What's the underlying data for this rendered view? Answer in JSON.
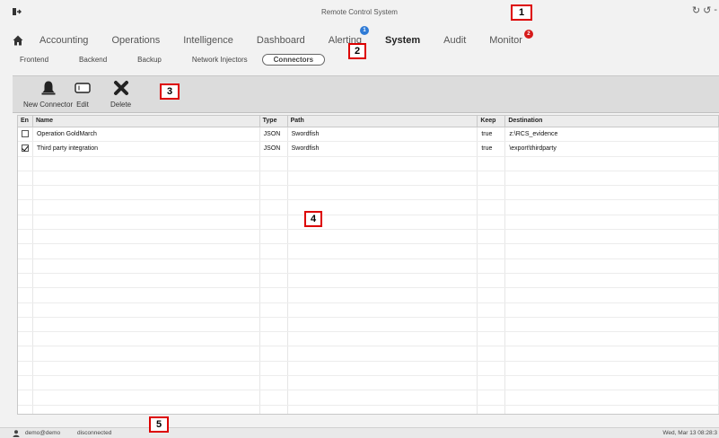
{
  "window": {
    "title": "Remote Control System"
  },
  "main_nav": {
    "items": [
      {
        "label": "Accounting",
        "active": false
      },
      {
        "label": "Operations",
        "active": false
      },
      {
        "label": "Intelligence",
        "active": false
      },
      {
        "label": "Dashboard",
        "active": false
      },
      {
        "label": "Alerting",
        "active": false,
        "badge": "1",
        "badge_color": "#2f7bd6"
      },
      {
        "label": "System",
        "active": true
      },
      {
        "label": "Audit",
        "active": false
      },
      {
        "label": "Monitor",
        "active": false,
        "badge": "2",
        "badge_color": "#d61a1a"
      }
    ]
  },
  "sub_nav": {
    "items": [
      {
        "label": "Frontend",
        "active": false
      },
      {
        "label": "Backend",
        "active": false
      },
      {
        "label": "Backup",
        "active": false
      },
      {
        "label": "Network Injectors",
        "active": false
      },
      {
        "label": "Connectors",
        "active": true
      }
    ]
  },
  "toolbar": {
    "new_connector": "New Connector",
    "edit": "Edit",
    "delete": "Delete"
  },
  "table": {
    "columns": [
      "En",
      "Name",
      "Type",
      "Path",
      "Keep",
      "Destination"
    ],
    "rows": [
      {
        "enabled": false,
        "name": "Operation GoldMarch",
        "type": "JSON",
        "path": "Swordfish",
        "keep": "true",
        "destination": "z:\\RCS_evidence"
      },
      {
        "enabled": true,
        "name": "Third party integration",
        "type": "JSON",
        "path": "Swordfish",
        "keep": "true",
        "destination": "\\export\\thirdparty"
      }
    ]
  },
  "status": {
    "user": "demo@demo",
    "connection": "disconnected",
    "datetime": "Wed, Mar 13  08:28:3"
  },
  "callouts": [
    "1",
    "2",
    "3",
    "4",
    "5"
  ],
  "icons": {
    "logout": "logout-icon",
    "home": "home-icon",
    "refresh": "refresh-icon",
    "new_connector": "bell-icon",
    "edit": "edit-icon",
    "delete": "delete-x-icon",
    "user": "user-icon"
  }
}
